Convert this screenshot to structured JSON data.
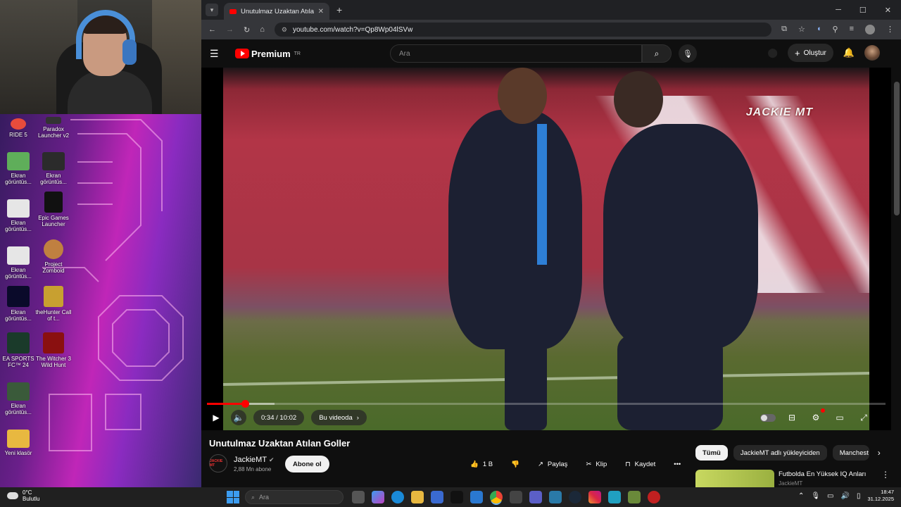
{
  "desktop": {
    "icons": [
      {
        "label": "RIDE 5",
        "color": "#e74c3c"
      },
      {
        "label": "Paradox Launcher v2",
        "color": "#333333"
      },
      {
        "label": "Ekran görüntüs...",
        "color": "#5fae5a"
      },
      {
        "label": "Ekran görüntüs...",
        "color": "#2b2b2b"
      },
      {
        "label": "Ekran görüntüs...",
        "color": "#e6e6e6"
      },
      {
        "label": "Epic Games Launcher",
        "color": "#111111"
      },
      {
        "label": "Ekran görüntüs...",
        "color": "#e6e6e6"
      },
      {
        "label": "Project Zomboid",
        "color": "#c08040"
      },
      {
        "label": "Ekran görüntüs...",
        "color": "#0a0a2a"
      },
      {
        "label": "theHunter Call of t...",
        "color": "#c8a030"
      },
      {
        "label": "EA SPORTS FC™ 24",
        "color": "#1a3a2a"
      },
      {
        "label": "The Witcher 3 Wild Hunt",
        "color": "#8a1010"
      },
      {
        "label": "Ekran görüntüs...",
        "color": "#3a5a3a"
      },
      {
        "label": "Yeni klasör",
        "color": "#e8b840"
      }
    ]
  },
  "browser": {
    "tab_title": "Unutulmaz Uzaktan Atılan Golle",
    "url": "youtube.com/watch?v=Qp8Wp04lSVw"
  },
  "youtube": {
    "logo_text": "Premium",
    "region": "TR",
    "search_placeholder": "Ara",
    "create_label": "Oluştur",
    "video": {
      "watermark": "JACKIE MT",
      "time_label": "0:34 / 10:02",
      "chapter_label": "Bu videoda",
      "progress_fraction": 0.0565,
      "buffered_fraction": 0.1
    },
    "title": "Unutulmaz Uzaktan Atılan Goller",
    "channel": {
      "name": "JackieMT",
      "avatar_text": "JACKIE MT",
      "subscribers": "2,88 Mn abone",
      "subscribe_label": "Abone ol"
    },
    "actions": {
      "likes": "1 B",
      "share": "Paylaş",
      "clip": "Klip",
      "save": "Kaydet"
    },
    "chips": [
      "Tümü",
      "JackieMT adlı yükleyiciden",
      "Manchest"
    ],
    "recommendation": {
      "title": "Futbolda En Yüksek IQ Anları",
      "channel": "JackieMT"
    }
  },
  "taskbar": {
    "temperature": "0°C",
    "condition": "Bulutlu",
    "search_placeholder": "Ara",
    "time": "18:47",
    "date": "31.12.2025"
  },
  "colors": {
    "brand_red": "#ff0000",
    "yt_bg": "#0f0f0f",
    "chrome_bar": "#35363a"
  }
}
